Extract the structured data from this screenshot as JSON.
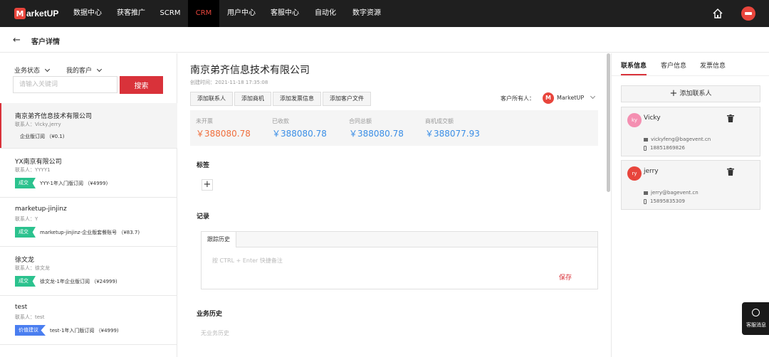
{
  "brand": {
    "logo_letter": "M",
    "logo_text": "arketUP"
  },
  "nav": {
    "items": [
      {
        "label": "数据中心"
      },
      {
        "label": "获客推广"
      },
      {
        "label": "SCRM"
      },
      {
        "label": "CRM"
      },
      {
        "label": "用户中心"
      },
      {
        "label": "客服中心"
      },
      {
        "label": "自动化"
      },
      {
        "label": "数字资源"
      }
    ],
    "active": "CRM"
  },
  "header": {
    "back": "←",
    "title": "客户详情"
  },
  "filters": {
    "status_label": "业务状态",
    "scope_label": "我的客户"
  },
  "search": {
    "placeholder": "请输入关键词",
    "button": "搜索"
  },
  "customers": [
    {
      "name": "南京弟齐信息技术有限公司",
      "contact": "联系人：Vicky,jerry",
      "deal": "企业版订阅 （¥0.1)"
    },
    {
      "name": "YX南京有限公司",
      "contact": "联系人：YYYY1",
      "tag": "成交",
      "deal": "YYY-1年入门版订阅 （¥4999)"
    },
    {
      "name": "marketup-jinjinz",
      "contact": "联系人：Y",
      "tag": "成交",
      "deal": "marketup-jinjinz-企业版套餐账号 （¥83.7)"
    },
    {
      "name": "徐文龙",
      "contact": "联系人：徐文龙",
      "tag": "成交",
      "deal": "徐文龙-1年企业版订阅 （¥24999)"
    },
    {
      "name": "test",
      "contact": "联系人：test",
      "tag": "价值建议",
      "deal": "test-1年入门版订阅 （¥4999)"
    }
  ],
  "colors": {
    "accent": "#d9323a",
    "deal_tag": "#2bc28e",
    "proposal_tag": "#4a7ef0",
    "blue_value": "#3a8ee6",
    "orange_value": "#f06e3c"
  },
  "detail": {
    "company": "南京弟齐信息技术有限公司",
    "created": "创建时间：2021-11-18 17:35:08",
    "actions": [
      "添加联系人",
      "添加商机",
      "添加发票信息",
      "添加客户文件"
    ],
    "owner_label": "客户所有人：",
    "owner_logo": "M",
    "owner_name": "MarketUP",
    "stats": [
      {
        "label": "未开票",
        "value": "￥388080.78"
      },
      {
        "label": "已收款",
        "value": "￥388080.78"
      },
      {
        "label": "合同总额",
        "value": "￥388080.78"
      },
      {
        "label": "商机成交额",
        "value": "￥388077.93"
      }
    ],
    "tags_title": "标签",
    "tags_add": "+",
    "records_title": "记录",
    "records_tab": "跟踪历史",
    "records_placeholder": "按 CTRL + Enter 快捷备注",
    "records_save": "保存",
    "history_title": "业务历史",
    "history_empty": "无业务历史"
  },
  "right": {
    "tabs": [
      "联系信息",
      "客户信息",
      "发票信息"
    ],
    "add_contact": "添加联系人",
    "add_plus": "+",
    "contacts": [
      {
        "initials": "ky",
        "name": "Vicky",
        "email": "vickyfeng@bagevent.cn",
        "phone": "18851869826",
        "avatar_color": "#f48fb1"
      },
      {
        "initials": "ry",
        "name": "jerry",
        "email": "jerry@bagevent.cn",
        "phone": "15895835309",
        "avatar_color": "#e8453c"
      }
    ]
  },
  "float_service": {
    "label": "客服消息"
  }
}
